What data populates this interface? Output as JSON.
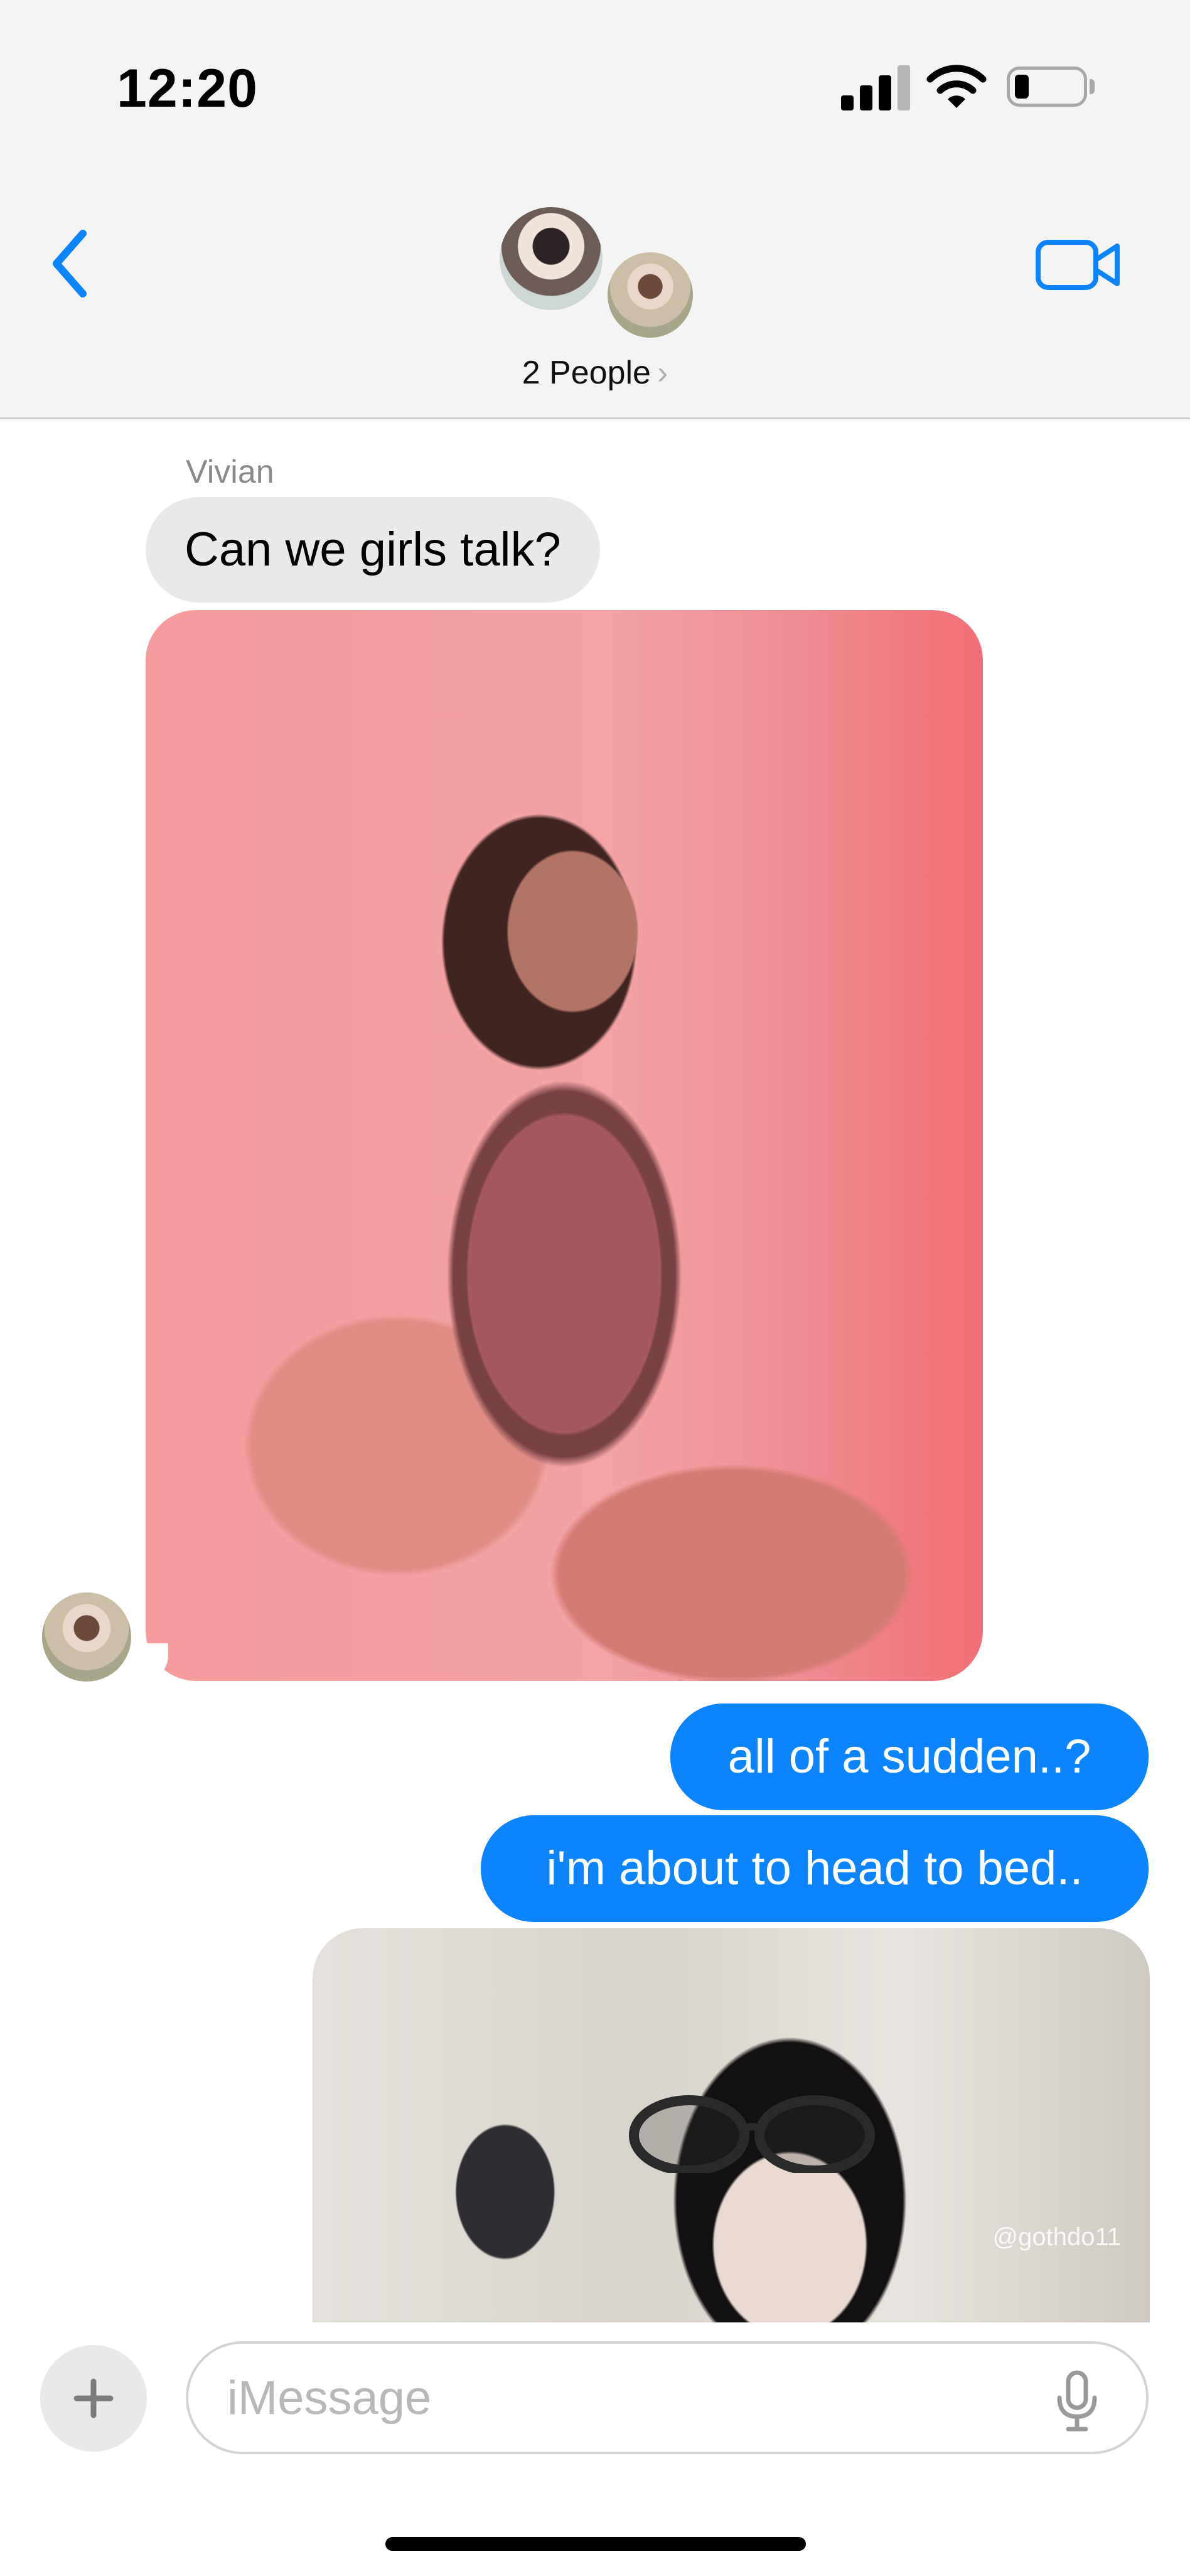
{
  "status_bar": {
    "time": "12:20",
    "signal_bars": 3,
    "battery_level": 0.15
  },
  "header": {
    "back_icon": "chevron-left-icon",
    "group_label": "2 People",
    "group_chevron": "›",
    "video_icon": "video-camera-icon",
    "accent_color": "#0b84fe"
  },
  "conversation": {
    "messages": [
      {
        "direction": "incoming",
        "sender": "Vivian",
        "type": "text",
        "text": "Can we girls talk?"
      },
      {
        "direction": "incoming",
        "sender": "Vivian",
        "type": "image"
      },
      {
        "direction": "outgoing",
        "type": "text",
        "text": "all of a sudden..?"
      },
      {
        "direction": "outgoing",
        "type": "text",
        "text": "i'm about to head to bed.."
      },
      {
        "direction": "outgoing",
        "type": "image",
        "watermark": "@gothdo11"
      }
    ]
  },
  "input": {
    "plus_icon": "plus-icon",
    "placeholder": "iMessage",
    "value": "",
    "mic_icon": "microphone-icon"
  },
  "colors": {
    "outgoing_bubble": "#0b84fe",
    "incoming_bubble": "#e9e9eb",
    "header_background": "#f4f4f4"
  }
}
